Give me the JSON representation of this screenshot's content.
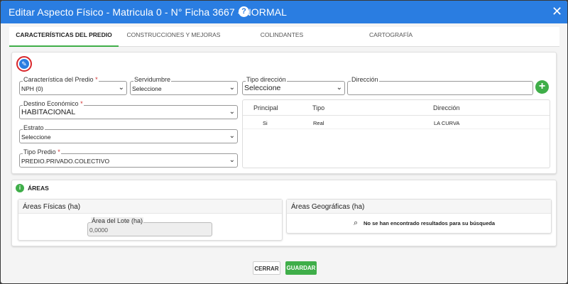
{
  "header": {
    "title": "Editar Aspecto Físico - Matricula 0 - N° Ficha 3667 - NORMAL",
    "help_glyph": "?",
    "close_glyph": "✕"
  },
  "tabs": [
    {
      "label": "CARACTERÍSTICAS DEL PREDIO",
      "active": true
    },
    {
      "label": "CONSTRUCCIONES Y MEJORAS"
    },
    {
      "label": "COLINDANTES"
    },
    {
      "label": "CARTOGRAFÍA"
    }
  ],
  "edit_icon": "pencil-icon",
  "form": {
    "caracteristica": {
      "label": "Característica del Predio",
      "required": "*",
      "value": "NPH (0)"
    },
    "servidumbre": {
      "label": "Servidumbre",
      "value": "Seleccione"
    },
    "tipo_direccion": {
      "label": "Tipo dirección",
      "value": "Seleccione"
    },
    "direccion": {
      "label": "Dirección",
      "value": ""
    },
    "destino": {
      "label": "Destino Económico",
      "required": "*",
      "value": "HABITACIONAL"
    },
    "estrato": {
      "label": "Estrato",
      "value": "Seleccione"
    },
    "tipo_predio": {
      "label": "Tipo Predio",
      "required": "*",
      "value": "PREDIO.PRIVADO.COLECTIVO"
    }
  },
  "add_glyph": "+",
  "address_table": {
    "columns": [
      "Principal",
      "Tipo",
      "Dirección"
    ],
    "rows": [
      {
        "principal": "Si",
        "tipo": "Real",
        "direccion": "LA CURVA"
      }
    ]
  },
  "areas": {
    "title": "ÁREAS",
    "info_glyph": "i",
    "fisicas": {
      "title": "Áreas Físicas (ha)",
      "lote_label": "Área del Lote (ha)",
      "lote_value": "0,0000"
    },
    "geograficas": {
      "title": "Áreas Geográficas (ha)",
      "empty_text": "No se han encontrado resultados para su búsqueda"
    }
  },
  "footer": {
    "cerrar": "CERRAR",
    "guardar": "GUARDAR"
  },
  "colors": {
    "header": "#2a7de1",
    "accent_green": "#3fae49",
    "required_red": "#d32f2f"
  }
}
